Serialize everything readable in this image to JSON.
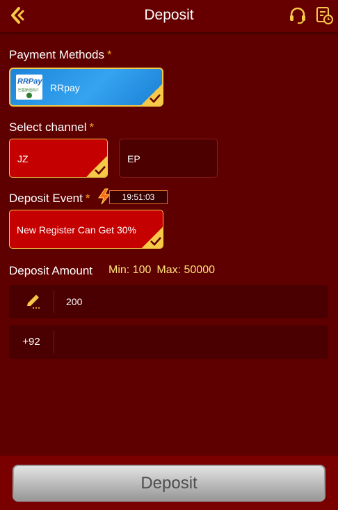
{
  "header": {
    "title": "Deposit",
    "back_icon": "back-chevron-icon",
    "support_icon": "headset-icon",
    "history_icon": "history-icon"
  },
  "payment_methods": {
    "label": "Payment Methods",
    "required_mark": "*",
    "selected": {
      "name": "RRpay",
      "logo_text": "RRPay",
      "logo_subtext": "巴基斯坦商户"
    }
  },
  "channels": {
    "label": "Select channel",
    "required_mark": "*",
    "items": [
      {
        "name": "JZ",
        "selected": true
      },
      {
        "name": "EP",
        "selected": false
      }
    ]
  },
  "deposit_event": {
    "label": "Deposit Event",
    "required_mark": "*",
    "timer": "19:51:03",
    "selected_event": "New Register Can Get 30%"
  },
  "deposit_amount": {
    "label": "Deposit Amount",
    "min_text": "Min: 100",
    "max_text": "Max: 50000",
    "value": "200",
    "pencil_icon": "pencil-icon"
  },
  "phone": {
    "prefix": "+92",
    "value": "",
    "placeholder": ""
  },
  "submit": {
    "label": "Deposit"
  },
  "colors": {
    "background": "#5e0000",
    "header": "#660000",
    "selected_card": "#c40000",
    "accent_gold": "#f7c948",
    "required": "#f5a623",
    "minmax_text": "#ffe27a",
    "input_bg": "#4a0000"
  }
}
